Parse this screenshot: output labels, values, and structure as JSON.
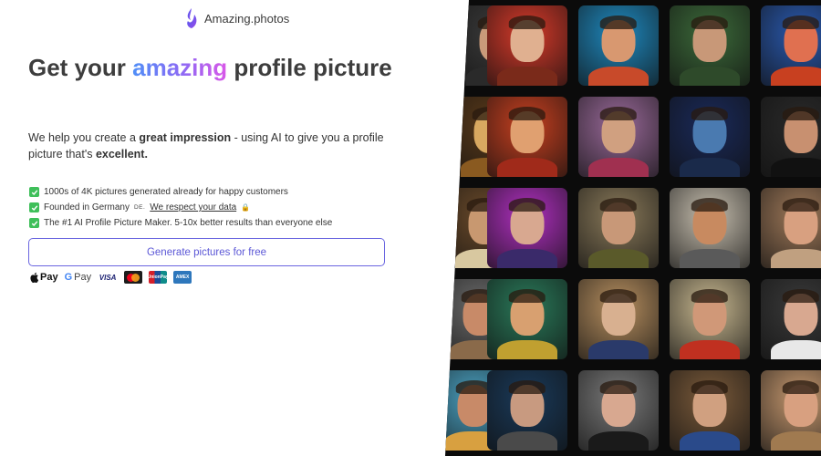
{
  "brand": {
    "name": "Amazing.photos"
  },
  "hero": {
    "headline_before": "Get your ",
    "headline_accent": "amazing",
    "headline_after": " profile picture",
    "lead_1": "We help you create a ",
    "lead_bold_1": "great impression",
    "lead_2": " - using AI to give you a profile picture that's ",
    "lead_bold_2": "excellent."
  },
  "features": {
    "item1": "1000s of 4K pictures generated already for happy customers",
    "item2_prefix": "Founded in Germany ",
    "item2_country": "DE.",
    "item2_link": "We respect your data",
    "item3": "The #1 AI Profile Picture Maker. 5-10x better results than everyone else"
  },
  "cta": {
    "label": "Generate pictures for free"
  },
  "payments": {
    "apple_pay": "Pay",
    "google_pay": "Pay",
    "visa": "VISA",
    "unionpay": "UnionPay",
    "amex": "AMEX"
  },
  "colors": {
    "accent_start": "#4f8ff7",
    "accent_end": "#d957e8",
    "cta_border": "#6a66e0",
    "check_green": "#3fbf5a"
  },
  "gallery": {
    "tiles": [
      {
        "bg": "#3a3a3a",
        "skin": "#c99a7a",
        "cloth": "#2a2a2a"
      },
      {
        "bg": "#d83a2a",
        "skin": "#e0b090",
        "cloth": "#7a2a1a"
      },
      {
        "bg": "#1f8ac0",
        "skin": "#d89870",
        "cloth": "#c84a2a"
      },
      {
        "bg": "#3c6a3a",
        "skin": "#c89878",
        "cloth": "#2e4a2a"
      },
      {
        "bg": "#2a5ab0",
        "skin": "#e07050",
        "cloth": "#c84020"
      },
      {
        "bg": "#5a3a1a",
        "skin": "#d8a860",
        "cloth": "#8a5a20"
      },
      {
        "bg": "#c84020",
        "skin": "#e0a070",
        "cloth": "#a02a1a"
      },
      {
        "bg": "#9a6a9a",
        "skin": "#d0a080",
        "cloth": "#a03050"
      },
      {
        "bg": "#1a2a5a",
        "skin": "#4a7ab0",
        "cloth": "#1a2a4a"
      },
      {
        "bg": "#2a2a2a",
        "skin": "#c89070",
        "cloth": "#111111"
      },
      {
        "bg": "#6a4a2a",
        "skin": "#c89870",
        "cloth": "#d8c8a0"
      },
      {
        "bg": "#b030c0",
        "skin": "#d8a890",
        "cloth": "#3a2a6a"
      },
      {
        "bg": "#8a7a5a",
        "skin": "#c89878",
        "cloth": "#5a5a2a"
      },
      {
        "bg": "#c8c0b0",
        "skin": "#c88a60",
        "cloth": "#5a5a5a"
      },
      {
        "bg": "#a07a5a",
        "skin": "#d8a080",
        "cloth": "#c0a080"
      },
      {
        "bg": "#6a6a6a",
        "skin": "#c88a68",
        "cloth": "#8a6a4a"
      },
      {
        "bg": "#2a7a5a",
        "skin": "#d8a070",
        "cloth": "#c0a030"
      },
      {
        "bg": "#b89060",
        "skin": "#d8b090",
        "cloth": "#2a3a6a"
      },
      {
        "bg": "#c8b890",
        "skin": "#d09878",
        "cloth": "#c03020"
      },
      {
        "bg": "#3a3a3a",
        "skin": "#d8a890",
        "cloth": "#e8e8e8"
      },
      {
        "bg": "#4aa0c0",
        "skin": "#c88a68",
        "cloth": "#d8a040"
      },
      {
        "bg": "#1a3a5a",
        "skin": "#c89a80",
        "cloth": "#4a4a4a"
      },
      {
        "bg": "#7a7a7a",
        "skin": "#d8a890",
        "cloth": "#1a1a1a"
      },
      {
        "bg": "#7a5a3a",
        "skin": "#d0a080",
        "cloth": "#2a4a8a"
      },
      {
        "bg": "#c89a70",
        "skin": "#d8a080",
        "cloth": "#a07a50"
      }
    ]
  }
}
